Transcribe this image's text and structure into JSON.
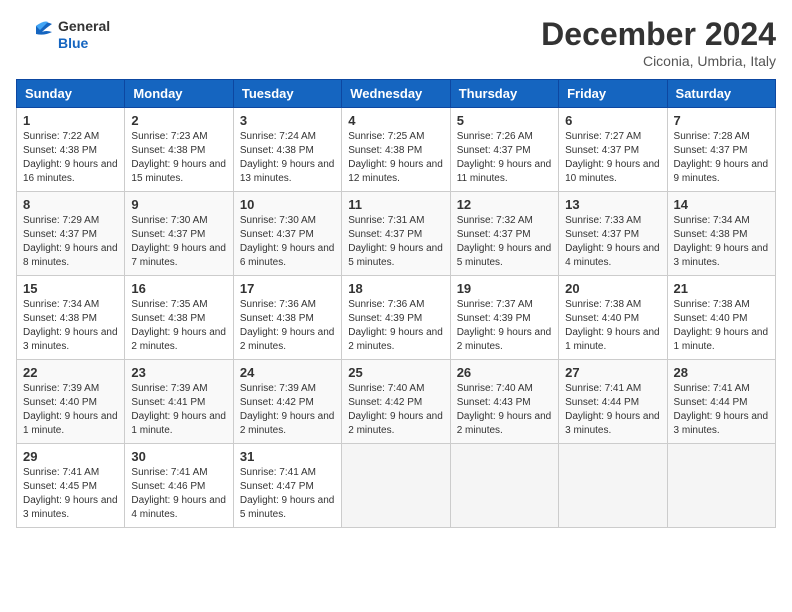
{
  "header": {
    "logo_general": "General",
    "logo_blue": "Blue",
    "month_title": "December 2024",
    "location": "Ciconia, Umbria, Italy"
  },
  "weekdays": [
    "Sunday",
    "Monday",
    "Tuesday",
    "Wednesday",
    "Thursday",
    "Friday",
    "Saturday"
  ],
  "weeks": [
    [
      {
        "day": 1,
        "info": "Sunrise: 7:22 AM\nSunset: 4:38 PM\nDaylight: 9 hours\nand 16 minutes."
      },
      {
        "day": 2,
        "info": "Sunrise: 7:23 AM\nSunset: 4:38 PM\nDaylight: 9 hours\nand 15 minutes."
      },
      {
        "day": 3,
        "info": "Sunrise: 7:24 AM\nSunset: 4:38 PM\nDaylight: 9 hours\nand 13 minutes."
      },
      {
        "day": 4,
        "info": "Sunrise: 7:25 AM\nSunset: 4:38 PM\nDaylight: 9 hours\nand 12 minutes."
      },
      {
        "day": 5,
        "info": "Sunrise: 7:26 AM\nSunset: 4:37 PM\nDaylight: 9 hours\nand 11 minutes."
      },
      {
        "day": 6,
        "info": "Sunrise: 7:27 AM\nSunset: 4:37 PM\nDaylight: 9 hours\nand 10 minutes."
      },
      {
        "day": 7,
        "info": "Sunrise: 7:28 AM\nSunset: 4:37 PM\nDaylight: 9 hours\nand 9 minutes."
      }
    ],
    [
      {
        "day": 8,
        "info": "Sunrise: 7:29 AM\nSunset: 4:37 PM\nDaylight: 9 hours\nand 8 minutes."
      },
      {
        "day": 9,
        "info": "Sunrise: 7:30 AM\nSunset: 4:37 PM\nDaylight: 9 hours\nand 7 minutes."
      },
      {
        "day": 10,
        "info": "Sunrise: 7:30 AM\nSunset: 4:37 PM\nDaylight: 9 hours\nand 6 minutes."
      },
      {
        "day": 11,
        "info": "Sunrise: 7:31 AM\nSunset: 4:37 PM\nDaylight: 9 hours\nand 5 minutes."
      },
      {
        "day": 12,
        "info": "Sunrise: 7:32 AM\nSunset: 4:37 PM\nDaylight: 9 hours\nand 5 minutes."
      },
      {
        "day": 13,
        "info": "Sunrise: 7:33 AM\nSunset: 4:37 PM\nDaylight: 9 hours\nand 4 minutes."
      },
      {
        "day": 14,
        "info": "Sunrise: 7:34 AM\nSunset: 4:38 PM\nDaylight: 9 hours\nand 3 minutes."
      }
    ],
    [
      {
        "day": 15,
        "info": "Sunrise: 7:34 AM\nSunset: 4:38 PM\nDaylight: 9 hours\nand 3 minutes."
      },
      {
        "day": 16,
        "info": "Sunrise: 7:35 AM\nSunset: 4:38 PM\nDaylight: 9 hours\nand 2 minutes."
      },
      {
        "day": 17,
        "info": "Sunrise: 7:36 AM\nSunset: 4:38 PM\nDaylight: 9 hours\nand 2 minutes."
      },
      {
        "day": 18,
        "info": "Sunrise: 7:36 AM\nSunset: 4:39 PM\nDaylight: 9 hours\nand 2 minutes."
      },
      {
        "day": 19,
        "info": "Sunrise: 7:37 AM\nSunset: 4:39 PM\nDaylight: 9 hours\nand 2 minutes."
      },
      {
        "day": 20,
        "info": "Sunrise: 7:38 AM\nSunset: 4:40 PM\nDaylight: 9 hours\nand 1 minute."
      },
      {
        "day": 21,
        "info": "Sunrise: 7:38 AM\nSunset: 4:40 PM\nDaylight: 9 hours\nand 1 minute."
      }
    ],
    [
      {
        "day": 22,
        "info": "Sunrise: 7:39 AM\nSunset: 4:40 PM\nDaylight: 9 hours\nand 1 minute."
      },
      {
        "day": 23,
        "info": "Sunrise: 7:39 AM\nSunset: 4:41 PM\nDaylight: 9 hours\nand 1 minute."
      },
      {
        "day": 24,
        "info": "Sunrise: 7:39 AM\nSunset: 4:42 PM\nDaylight: 9 hours\nand 2 minutes."
      },
      {
        "day": 25,
        "info": "Sunrise: 7:40 AM\nSunset: 4:42 PM\nDaylight: 9 hours\nand 2 minutes."
      },
      {
        "day": 26,
        "info": "Sunrise: 7:40 AM\nSunset: 4:43 PM\nDaylight: 9 hours\nand 2 minutes."
      },
      {
        "day": 27,
        "info": "Sunrise: 7:41 AM\nSunset: 4:44 PM\nDaylight: 9 hours\nand 3 minutes."
      },
      {
        "day": 28,
        "info": "Sunrise: 7:41 AM\nSunset: 4:44 PM\nDaylight: 9 hours\nand 3 minutes."
      }
    ],
    [
      {
        "day": 29,
        "info": "Sunrise: 7:41 AM\nSunset: 4:45 PM\nDaylight: 9 hours\nand 3 minutes."
      },
      {
        "day": 30,
        "info": "Sunrise: 7:41 AM\nSunset: 4:46 PM\nDaylight: 9 hours\nand 4 minutes."
      },
      {
        "day": 31,
        "info": "Sunrise: 7:41 AM\nSunset: 4:47 PM\nDaylight: 9 hours\nand 5 minutes."
      },
      null,
      null,
      null,
      null
    ]
  ]
}
